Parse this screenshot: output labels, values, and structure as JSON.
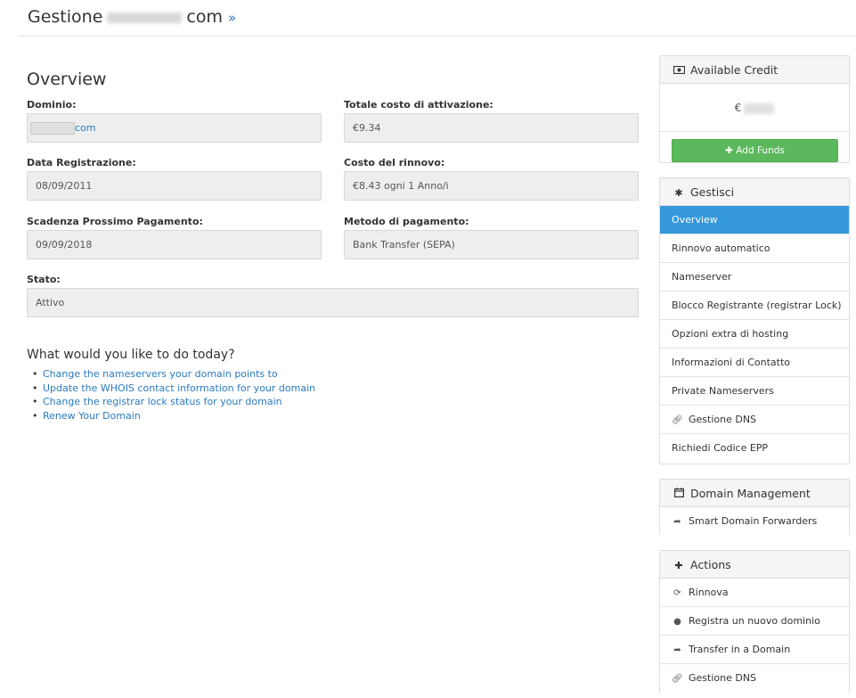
{
  "header": {
    "title_prefix": "Gestione",
    "title_suffix": "com",
    "chevron": "»"
  },
  "overview": {
    "title": "Overview",
    "fields": {
      "domain": {
        "label": "Dominio:",
        "value": "com"
      },
      "total_cost": {
        "label": "Totale costo di attivazione:",
        "value": "€9.34"
      },
      "reg_date": {
        "label": "Data Registrazione:",
        "value": "08/09/2011"
      },
      "renewal_cost": {
        "label": "Costo del rinnovo:",
        "value": "€8.43 ogni 1 Anno/i"
      },
      "next_due": {
        "label": "Scadenza Prossimo Pagamento:",
        "value": "09/09/2018"
      },
      "payment_method": {
        "label": "Metodo di pagamento:",
        "value": "Bank Transfer (SEPA)"
      },
      "status": {
        "label": "Stato:",
        "value": "Attivo"
      }
    }
  },
  "today": {
    "title": "What would you like to do today?",
    "links": [
      "Change the nameservers your domain points to",
      "Update the WHOIS contact information for your domain",
      "Change the registrar lock status for your domain",
      "Renew Your Domain"
    ]
  },
  "credit": {
    "title": "Available Credit",
    "currency": "€",
    "add_funds": "Add Funds"
  },
  "gestisci": {
    "title": "Gestisci",
    "items": [
      "Overview",
      "Rinnovo automatico",
      "Nameserver",
      "Blocco Registrante (registrar Lock)",
      "Opzioni extra di hosting",
      "Informazioni di Contatto",
      "Private Nameservers",
      "Gestione DNS",
      "Richiedi Codice EPP"
    ]
  },
  "domain_mgmt": {
    "title": "Domain Management",
    "items": [
      "Smart Domain Forwarders"
    ]
  },
  "actions": {
    "title": "Actions",
    "items": [
      "Rinnova",
      "Registra un nuovo dominio",
      "Transfer in a Domain",
      "Gestione DNS"
    ]
  },
  "colors": {
    "accent": "#3498db",
    "link": "#2a7ac0",
    "success": "#5cb85c"
  }
}
